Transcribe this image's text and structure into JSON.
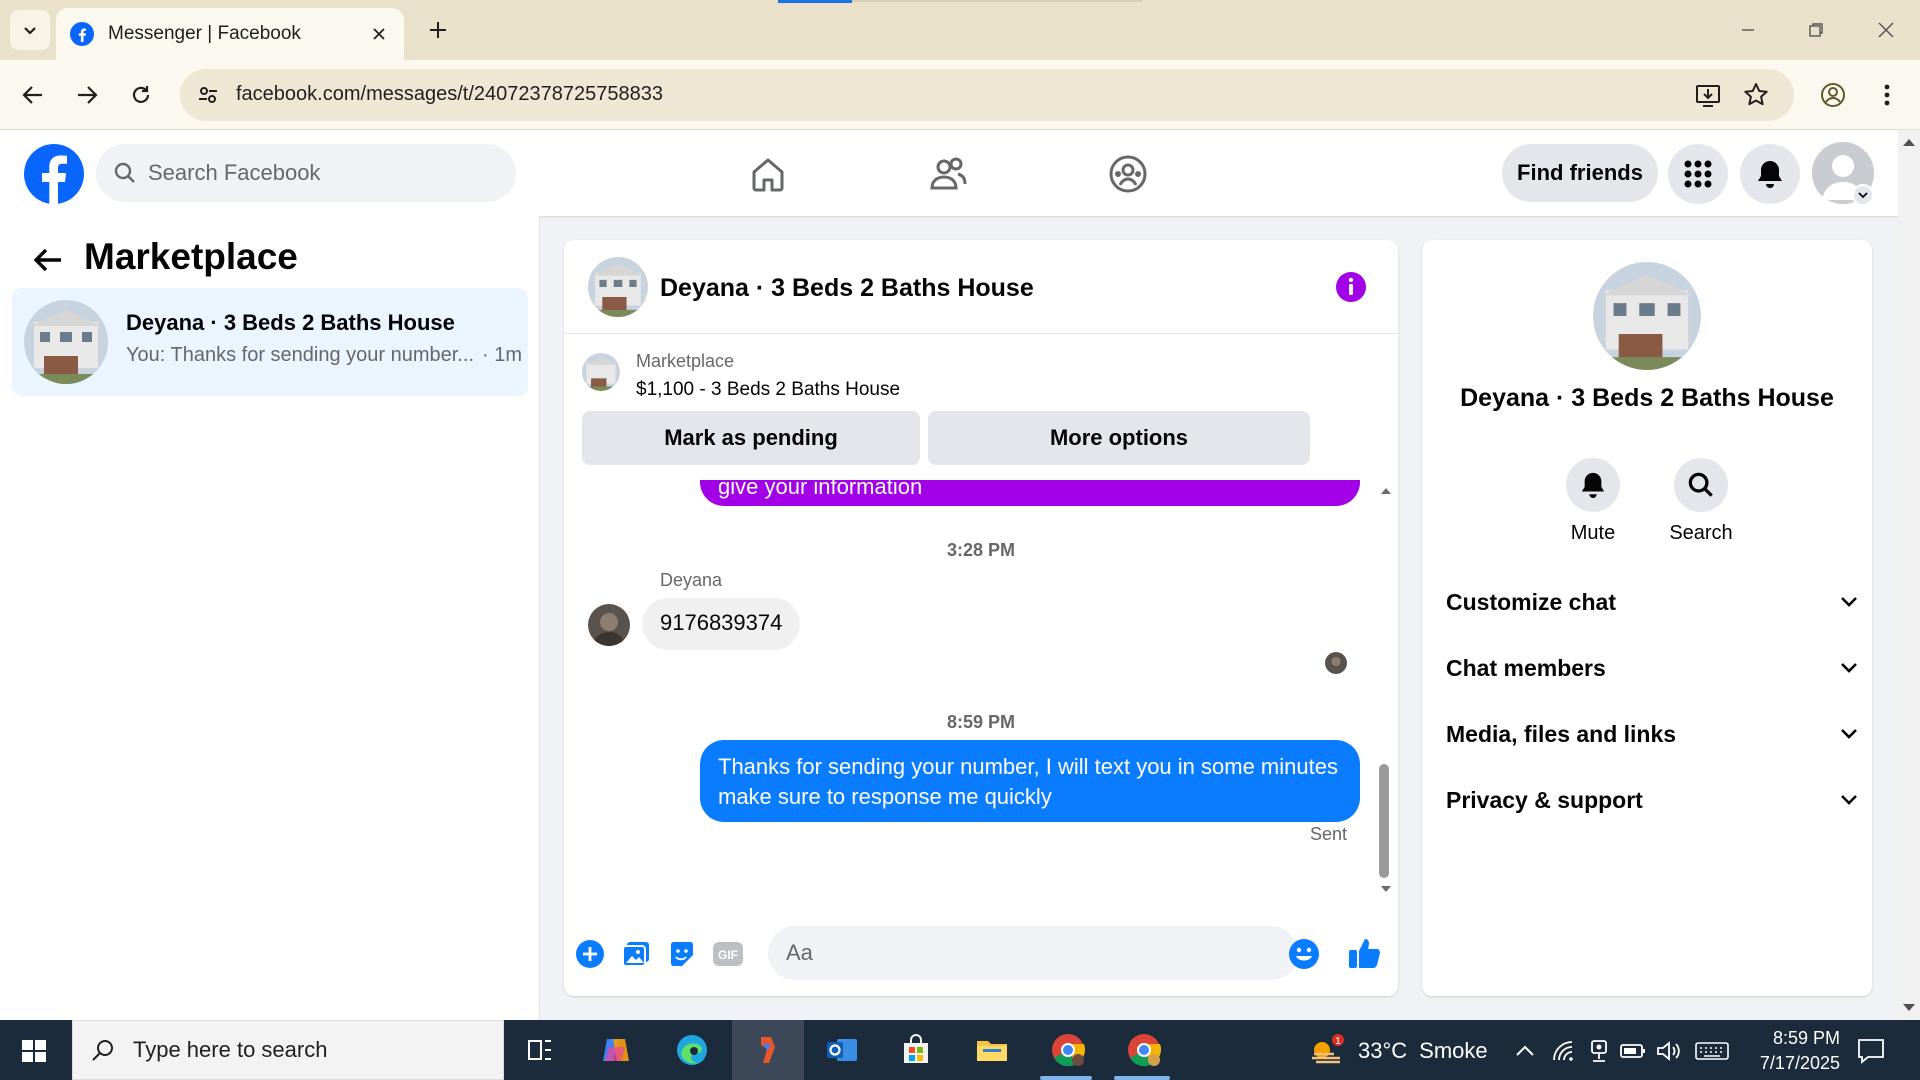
{
  "browser": {
    "tab_title": "Messenger | Facebook",
    "url": "facebook.com/messages/t/24072378725758833"
  },
  "fb_header": {
    "search_placeholder": "Search Facebook",
    "find_friends_label": "Find friends"
  },
  "left": {
    "title": "Marketplace",
    "conversation": {
      "name": "Deyana · 3 Beds 2 Baths House",
      "preview": "You: Thanks for sending your number...",
      "time": "· 1m"
    }
  },
  "chat": {
    "title": "Deyana · 3 Beds 2 Baths House",
    "listing_source": "Marketplace",
    "listing_price": "$1,100 - 3 Beds 2 Baths House",
    "mark_pending_label": "Mark as pending",
    "more_options_label": "More options",
    "partial_message": "give your information",
    "timestamp_1": "3:28 PM",
    "sender_name": "Deyana",
    "incoming_message": "9176839374",
    "timestamp_2": "8:59 PM",
    "outgoing_message": "Thanks for sending your number, I will text you in some minutes make sure to response me quickly",
    "status": "Sent",
    "input_placeholder": "Aa"
  },
  "info_panel": {
    "name": "Deyana · 3 Beds 2 Baths House",
    "actions": [
      "Mute",
      "Search"
    ],
    "sections": [
      "Customize chat",
      "Chat members",
      "Media, files and links",
      "Privacy & support"
    ]
  },
  "taskbar": {
    "search_placeholder": "Type here to search",
    "weather_temp": "33°C",
    "weather_condition": "Smoke",
    "weather_badge": "1",
    "time": "8:59 PM",
    "date": "7/17/2025"
  },
  "colors": {
    "facebook_blue": "#0866ff",
    "purple_bubble": "#a200e6",
    "blue_bubble": "#0a7cff",
    "selected_row": "#ebf5ff",
    "info_icon": "#a200e6"
  }
}
